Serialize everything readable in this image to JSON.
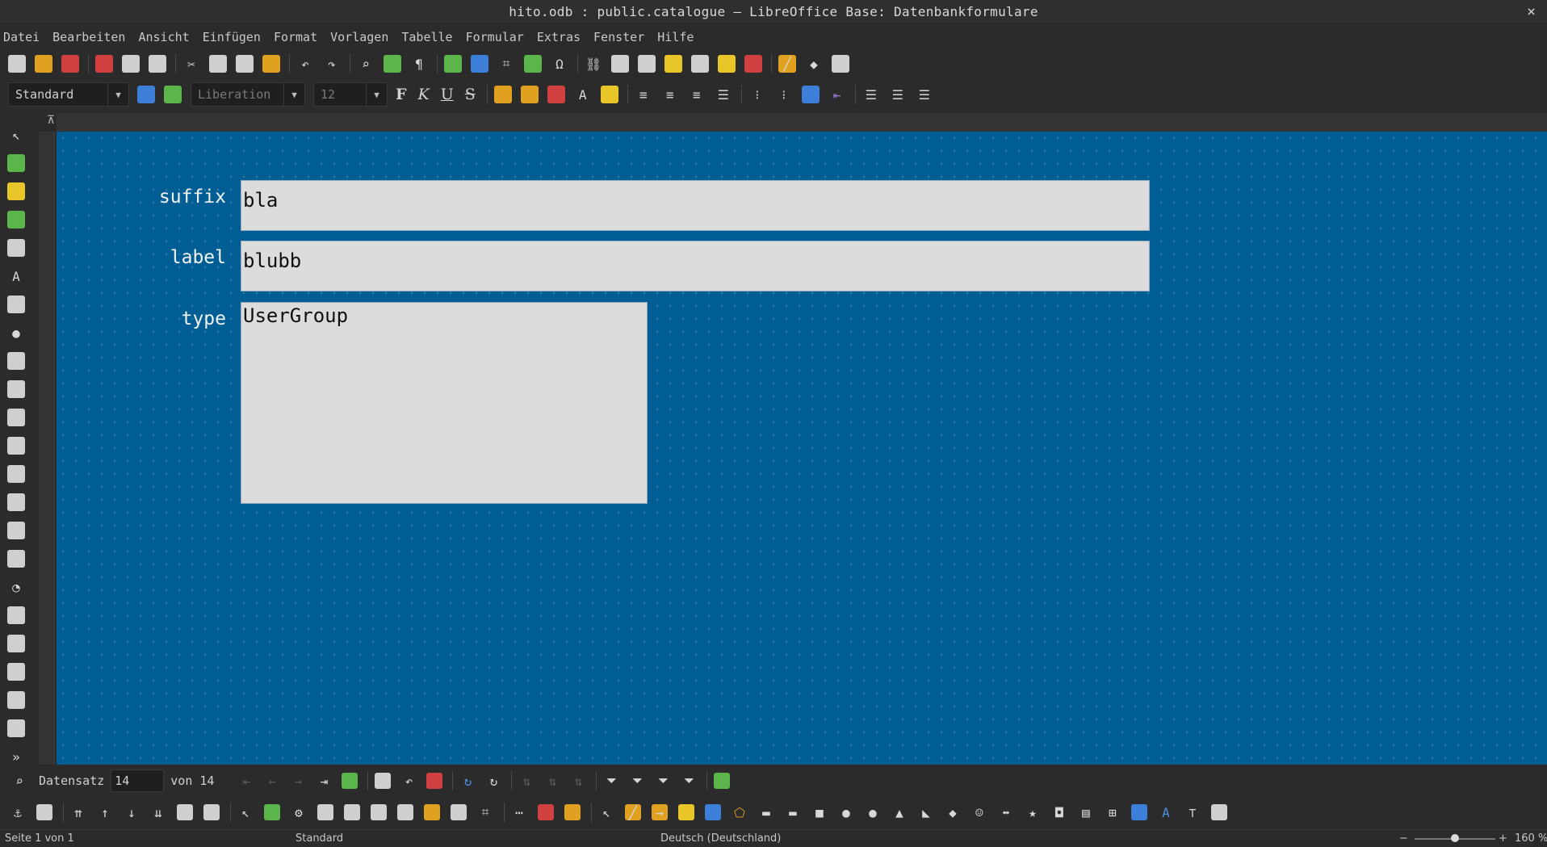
{
  "window": {
    "title": "hito.odb : public.catalogue – LibreOffice Base: Datenbankformulare",
    "close": "×"
  },
  "menu": [
    "Datei",
    "Bearbeiten",
    "Ansicht",
    "Einfügen",
    "Format",
    "Vorlagen",
    "Tabelle",
    "Formular",
    "Extras",
    "Fenster",
    "Hilfe"
  ],
  "format_toolbar": {
    "paragraph_style": "Standard",
    "font_name": "Liberation",
    "font_size": "12",
    "bold": "F",
    "italic": "K",
    "underline": "U",
    "strikethrough": "S"
  },
  "form": {
    "fields": [
      {
        "label": "suffix",
        "value": "bla"
      },
      {
        "label": "label",
        "value": "blubb"
      },
      {
        "label": "type",
        "value": "UserGroup"
      }
    ]
  },
  "record_nav": {
    "label": "Datensatz",
    "current": "14",
    "of_label": "von 14"
  },
  "status": {
    "page": "Seite 1 von 1",
    "style": "Standard",
    "language": "Deutsch (Deutschland)",
    "zoom": "160 %",
    "zoom_minus": "−",
    "zoom_plus": "+"
  },
  "colors": {
    "canvas": "#005e94",
    "field_bg": "#dcdcdc",
    "chrome": "#2b2b2b"
  }
}
